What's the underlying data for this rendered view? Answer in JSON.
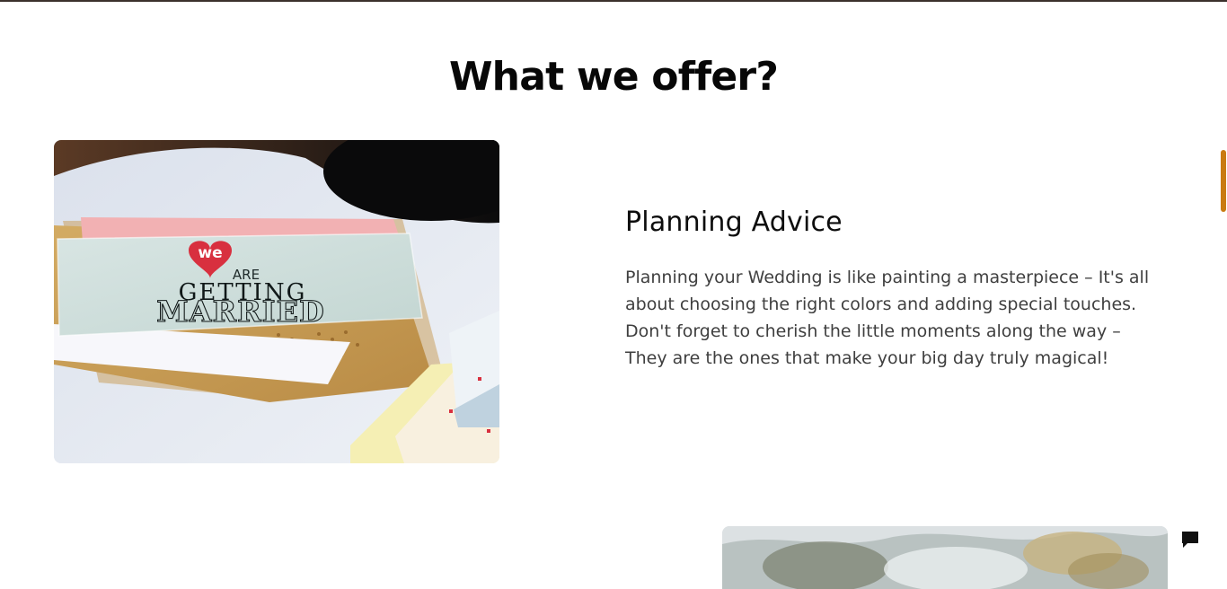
{
  "section": {
    "title": "What we offer?"
  },
  "feature": {
    "title": "Planning Advice",
    "description": "Planning your Wedding is like painting a masterpiece – It's all about choosing the right colors and adding special touches. Don't forget to cherish the little moments along the way – They are the ones that make your big day truly magical!",
    "image_text": {
      "line1": "we",
      "line2": "ARE",
      "line3": "GETTING",
      "line4": "MARRIED"
    }
  },
  "icons": {
    "chat": "chat-bubble-icon"
  },
  "colors": {
    "accent": "#c97b12",
    "heading": "#070707",
    "body_text": "#3f3f3f",
    "card_red": "#d8303f"
  }
}
